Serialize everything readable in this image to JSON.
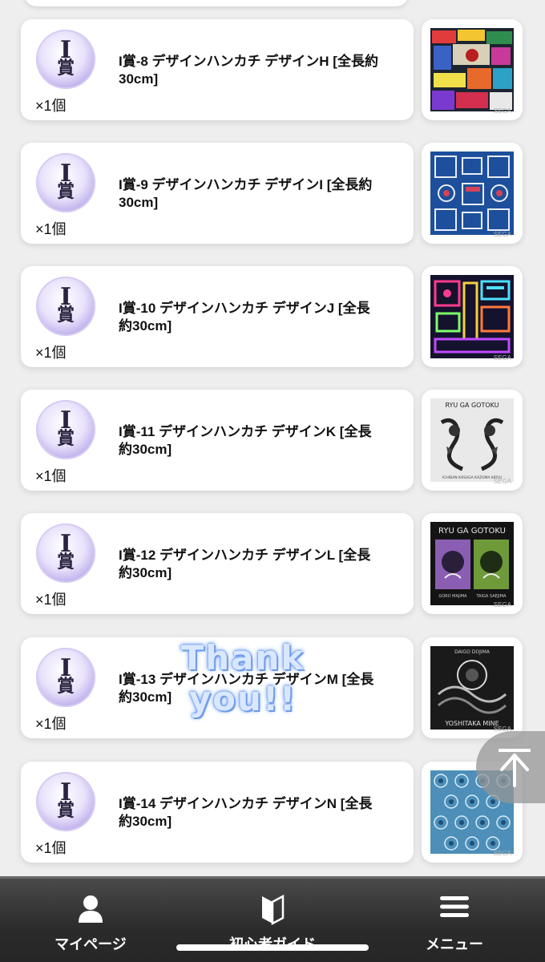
{
  "prizes": [
    {
      "badge_letter": "I",
      "badge_kanji": "賞",
      "title": "I賞-8 デザインハンカチ デザインH [全長約30cm]",
      "quantity": "×1個",
      "image": "neon-signboard-collage"
    },
    {
      "badge_letter": "I",
      "badge_kanji": "賞",
      "title": "I賞-9 デザインハンカチ デザインI [全長約30cm]",
      "quantity": "×1個",
      "image": "blue-sign-pattern"
    },
    {
      "badge_letter": "I",
      "badge_kanji": "賞",
      "title": "I賞-10 デザインハンカチ デザインJ [全長約30cm]",
      "quantity": "×1個",
      "image": "neon-road-night"
    },
    {
      "badge_letter": "I",
      "badge_kanji": "賞",
      "title": "I賞-11 デザインハンカチ デザインK [全長約30cm]",
      "quantity": "×1個",
      "image": "dragon-tattoo-white"
    },
    {
      "badge_letter": "I",
      "badge_kanji": "賞",
      "title": "I賞-12 デザインハンカチ デザインL [全長約30cm]",
      "quantity": "×1個",
      "image": "tattoo-panels-black"
    },
    {
      "badge_letter": "I",
      "badge_kanji": "賞",
      "title": "I賞-13 デザインハンカチ デザインM [全長約30cm]",
      "quantity": "×1個",
      "image": "daigo-dojima-tattoo"
    },
    {
      "badge_letter": "I",
      "badge_kanji": "賞",
      "title": "I賞-14 デザインハンカチ デザインN [全長約30cm]",
      "quantity": "×1個",
      "image": "blue-crest-pattern"
    }
  ],
  "thumbnail_watermark": "SEGA",
  "thumb_texts": {
    "k_heading": "RYU GA GOTOKU",
    "k_caption": "ICHIBAN KASUGA  KAZUMA KIRYU",
    "l_heading": "RYU GA GOTOKU",
    "l_left": "GORO MAJIMA",
    "l_right": "TAIGA SAEJIMA",
    "m_top": "DAIGO DOJIMA",
    "m_bottom": "YOSHITAKA MINE"
  },
  "overlay": {
    "line1": "Thank",
    "line2": "you!!"
  },
  "scroll_top": {
    "icon": "arrow-up-to-top-icon"
  },
  "nav": {
    "mypage": {
      "label": "マイページ",
      "icon": "person-icon"
    },
    "guide": {
      "label": "初心者ガイド",
      "icon": "beginner-mark-icon"
    },
    "menu": {
      "label": "メニュー",
      "icon": "hamburger-icon"
    }
  },
  "colors": {
    "badge_purple": "#b5a4e8",
    "nav_bg": "#2b2b2b",
    "background": "#eeeeee"
  }
}
